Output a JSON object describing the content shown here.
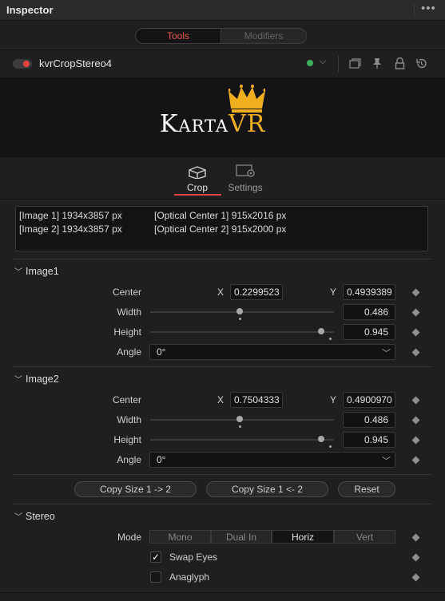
{
  "header": {
    "title": "Inspector",
    "more_icon": "more-dots-icon"
  },
  "mode_tabs": [
    {
      "label": "Tools",
      "active": true
    },
    {
      "label": "Modifiers",
      "active": false
    }
  ],
  "node": {
    "name": "kvrCropStereo4",
    "enabled": true
  },
  "logo": {
    "text_main": "Karta",
    "text_accent": "VR",
    "accent_color": "#f0b01e"
  },
  "tool_tabs": [
    {
      "label": "Crop",
      "icon": "crop-cube-icon",
      "active": true
    },
    {
      "label": "Settings",
      "icon": "settings-gear-icon",
      "active": false
    }
  ],
  "info": {
    "lines": [
      {
        "left": "[Image 1] 1934x3857 px",
        "right": "[Optical Center 1] 915x2016 px"
      },
      {
        "left": "[Image 2] 1934x3857 px",
        "right": "[Optical Center 2] 915x2000 px"
      }
    ]
  },
  "image1": {
    "title": "Image1",
    "center_label": "Center",
    "x_label": "X",
    "y_label": "Y",
    "center_x": "0.2299523",
    "center_y": "0.4939389",
    "width_label": "Width",
    "width_value": "0.486",
    "width_fraction": 0.486,
    "height_label": "Height",
    "height_value": "0.945",
    "height_fraction": 0.945,
    "angle_label": "Angle",
    "angle_value": "0°"
  },
  "image2": {
    "title": "Image2",
    "center_label": "Center",
    "x_label": "X",
    "y_label": "Y",
    "center_x": "0.7504333",
    "center_y": "0.4900970",
    "width_label": "Width",
    "width_value": "0.486",
    "width_fraction": 0.486,
    "height_label": "Height",
    "height_value": "0.945",
    "height_fraction": 0.945,
    "angle_label": "Angle",
    "angle_value": "0°"
  },
  "buttons": {
    "copy_1_to_2": "Copy Size 1 -> 2",
    "copy_2_to_1": "Copy Size 1 <- 2",
    "reset": "Reset"
  },
  "stereo": {
    "title": "Stereo",
    "mode_label": "Mode",
    "modes": [
      {
        "label": "Mono",
        "active": false
      },
      {
        "label": "Dual In",
        "active": false
      },
      {
        "label": "Horiz",
        "active": true
      },
      {
        "label": "Vert",
        "active": false
      }
    ],
    "swap_eyes_label": "Swap Eyes",
    "swap_eyes_checked": true,
    "anaglyph_label": "Anaglyph",
    "anaglyph_checked": false
  },
  "colors": {
    "accent_red": "#e3453c",
    "status_green": "#3fae5d",
    "background": "#1f1f21"
  }
}
